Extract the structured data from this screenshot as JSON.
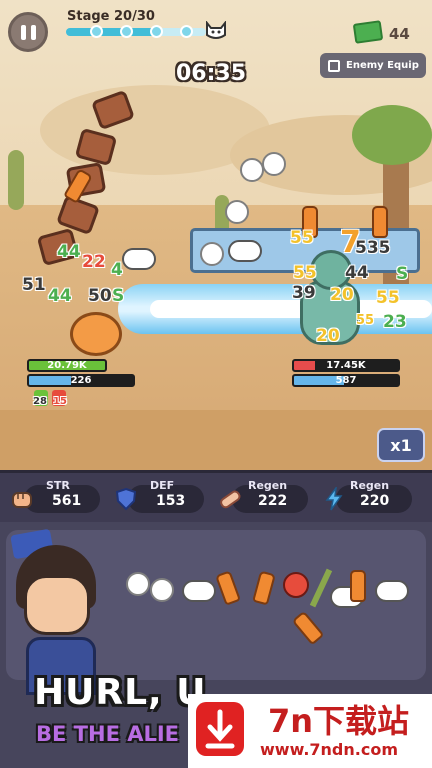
{
  "hud": {
    "stage": "Stage 20/30",
    "stage_progress": 0.67,
    "cash": "44",
    "timer": "06:35",
    "enemy_equip_label": "Enemy Equip",
    "speed_label": "x1"
  },
  "player": {
    "hp": "20.79K",
    "hp_fraction": 1.0,
    "energy": "226",
    "buff_a": "28",
    "buff_b": "15"
  },
  "enemy": {
    "hp": "17.45K",
    "hp_fraction": 0.2,
    "energy": "587"
  },
  "damage_numbers": {
    "left": [
      "44",
      "22",
      "4",
      "51",
      "44",
      "50",
      "S"
    ],
    "right": [
      "55",
      "7",
      "535",
      "55",
      "44",
      "S",
      "39",
      "20",
      "55",
      "23",
      "20",
      "55"
    ]
  },
  "stats": [
    {
      "name": "STR",
      "value": "561",
      "icon": "fist-icon"
    },
    {
      "name": "DEF",
      "value": "153",
      "icon": "shield-icon"
    },
    {
      "name": "Regen",
      "value": "222",
      "icon": "bandage-icon"
    },
    {
      "name": "Regen",
      "value": "220",
      "icon": "lightning-icon"
    }
  ],
  "promo": {
    "headline": "HURL, U",
    "subline": "BE THE ALIE"
  },
  "watermark": {
    "title": "7n下载站",
    "url": "www.7ndn.com"
  },
  "colors": {
    "player_hp": "#6ac23a",
    "enemy_hp": "#e74c4c",
    "energy": "#66b6ea",
    "stat_bg": "#3e3b52"
  }
}
